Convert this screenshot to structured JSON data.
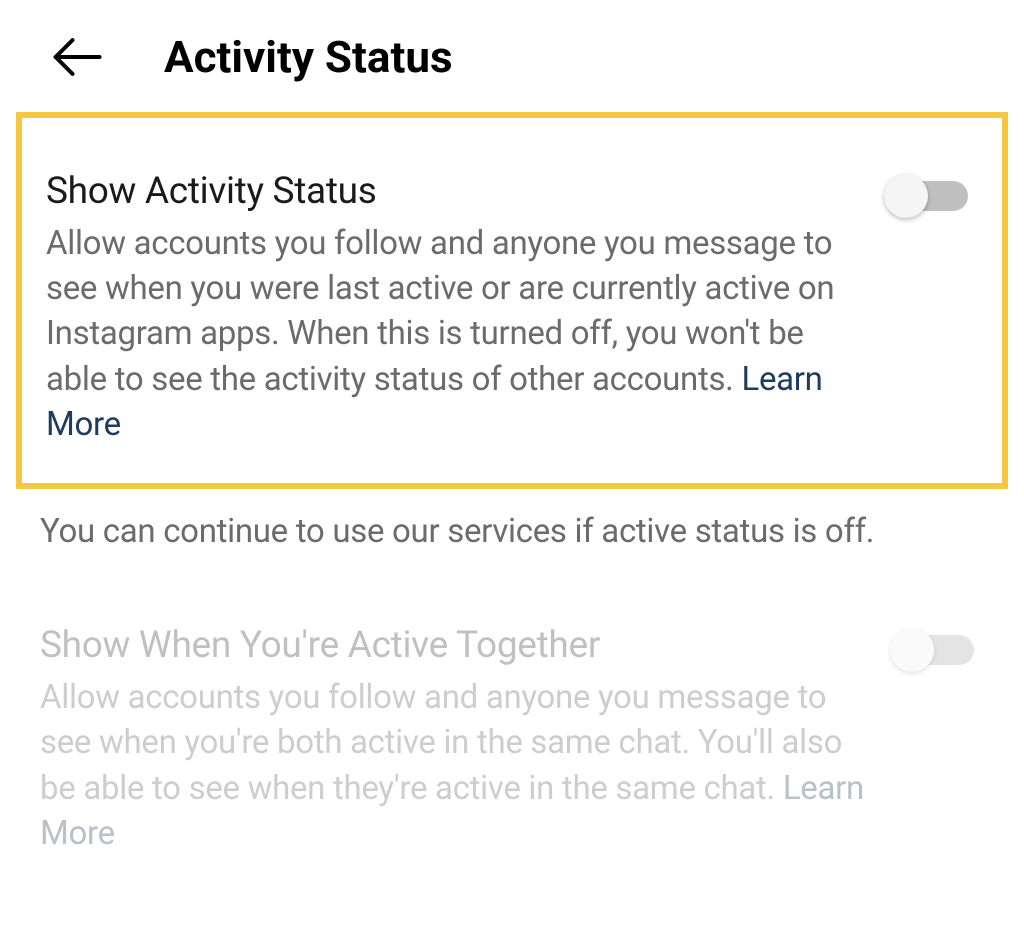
{
  "header": {
    "title": "Activity Status"
  },
  "settings": {
    "showActivityStatus": {
      "title": "Show Activity Status",
      "description": "Allow accounts you follow and anyone you message to see when you were last active or are currently active on Instagram apps. When this is turned off, you won't be able to see the activity status of other accounts. ",
      "learnMore": "Learn More",
      "enabled": false
    },
    "continueNote": "You can continue to use our services if active status is off.",
    "showActiveTogether": {
      "title": "Show When You're Active Together",
      "description": "Allow accounts you follow and anyone you message to see when you're both active in the same chat. You'll also be able to see when they're active in the same chat. ",
      "learnMore": "Learn More",
      "enabled": false
    }
  }
}
